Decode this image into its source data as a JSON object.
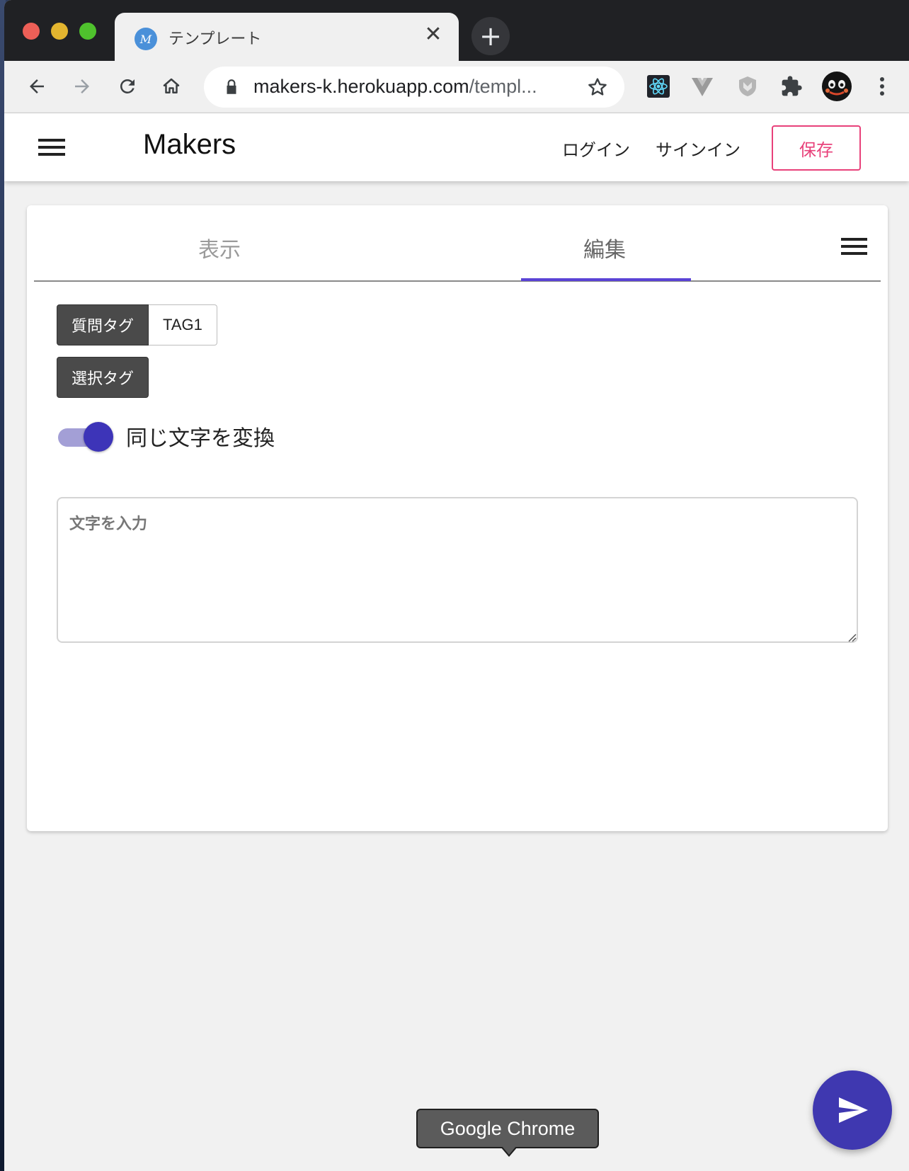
{
  "browser": {
    "tab_title": "テンプレート",
    "tab_favicon_letter": "M",
    "close_glyph": "✕",
    "new_tab_glyph": "+",
    "url_domain": "makers-k.herokuapp.com",
    "url_path": "/templ...",
    "icons": [
      "back-icon",
      "forward-icon",
      "reload-icon",
      "home-icon",
      "lock-icon",
      "star-icon",
      "react-devtools-icon",
      "vue-devtools-icon",
      "shield-extension-icon",
      "extensions-icon",
      "profile-avatar",
      "more-menu-icon"
    ],
    "colors": {
      "tab_strip": "#202124",
      "toolbar": "#f0f0f0"
    }
  },
  "header": {
    "brand": "Makers",
    "login": "ログイン",
    "signin": "サインイン",
    "save": "保存",
    "accent": "#e8417a"
  },
  "card": {
    "tabs": [
      {
        "label": "表示",
        "selected": false
      },
      {
        "label": "編集",
        "selected": true
      }
    ],
    "tab_indicator_color": "#5a43d6",
    "question_tag_label": "質問タグ",
    "question_tag_value": "TAG1",
    "choice_tag_label": "選択タグ",
    "toggle": {
      "label": "同じ文字を変換",
      "on": true
    },
    "text_input_placeholder": "文字を入力"
  },
  "tooltip": {
    "text": "Google Chrome"
  },
  "fab": {
    "icon": "send-icon",
    "color": "#3f38b0"
  }
}
